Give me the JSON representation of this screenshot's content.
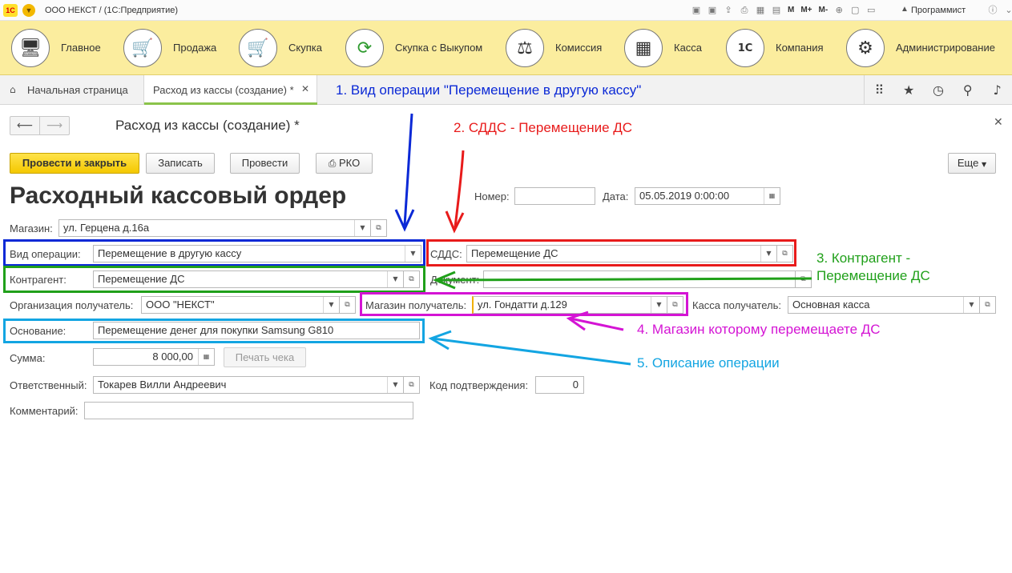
{
  "titlebar": {
    "logo": "1С",
    "title": "ООО НЕКСТ /  (1С:Предприятие)",
    "icons_mid": [
      "disk-icon",
      "disk-icon",
      "upload-icon",
      "print-icon",
      "calculator-icon",
      "calendar-icon"
    ],
    "mem_labels": [
      "M",
      "M+",
      "M-"
    ],
    "user": "Программист"
  },
  "sections": [
    {
      "label": "Главное",
      "icon": "monitor-icon"
    },
    {
      "label": "Продажа",
      "icon": "cart-up-icon"
    },
    {
      "label": "Скупка",
      "icon": "cart-down-icon"
    },
    {
      "label": "Скупка с Выкупом",
      "icon": "cycle-icon"
    },
    {
      "label": "Комиссия",
      "icon": "scales-icon"
    },
    {
      "label": "Касса",
      "icon": "cash-register-icon"
    },
    {
      "label": "Компания",
      "icon": "company-icon"
    },
    {
      "label": "Администрирование",
      "icon": "gears-icon"
    }
  ],
  "tabs": {
    "home": "Начальная страница",
    "active": "Расход из кассы (создание) *"
  },
  "annotations": {
    "a1": "1. Вид операции \"Перемещение в другую кассу\"",
    "a2": "2. СДДС - Перемещение ДС",
    "a3_line1": "3. Контрагент -",
    "a3_line2": "Перемещение ДС",
    "a4": "4. Магазин которому перемещаете ДС",
    "a5": "5. Описание операции",
    "colors": {
      "blue": "#0b29d6",
      "red": "#e81b1b",
      "green": "#20a01a",
      "pink": "#d414d4",
      "cyan": "#13a5e2"
    }
  },
  "form": {
    "title": "Расход из кассы (создание) *",
    "buttons": {
      "post_close": "Провести и закрыть",
      "save": "Записать",
      "post": "Провести",
      "rko": "РКО",
      "more": "Еще"
    },
    "doc_title": "Расходный кассовый ордер",
    "number_label": "Номер:",
    "number_value": "",
    "date_label": "Дата:",
    "date_value": "05.05.2019  0:00:00",
    "store_label": "Магазин:",
    "store_value": "ул. Герцена д.16а",
    "op_label": "Вид операции:",
    "op_value": "Перемещение в другую кассу",
    "sdds_label": "СДДС:",
    "sdds_value": "Перемещение ДС",
    "contractor_label": "Контрагент:",
    "contractor_value": "Перемещение ДС",
    "document_label": "Документ:",
    "document_value": "",
    "org_label": "Организация получатель:",
    "org_value": "ООО \"НЕКСТ\"",
    "store_recv_label": "Магазин получатель:",
    "store_recv_value": "ул. Гондатти д.129",
    "cash_recv_label": "Касса получатель:",
    "cash_recv_value": "Основная касса",
    "basis_label": "Основание:",
    "basis_value": "Перемещение денег для покупки Samsung G810",
    "sum_label": "Сумма:",
    "sum_value": "8 000,00",
    "print_check": "Печать чека",
    "resp_label": "Ответственный:",
    "resp_value": "Токарев Вилли Андреевич",
    "confirm_label": "Код подтверждения:",
    "confirm_value": "0",
    "comment_label": "Комментарий:",
    "comment_value": ""
  }
}
